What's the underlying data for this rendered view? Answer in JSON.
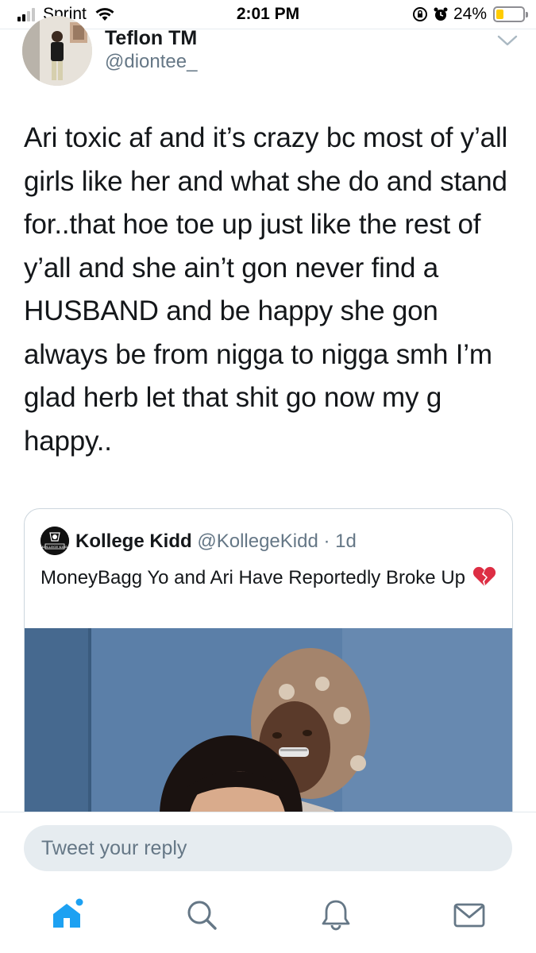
{
  "status_bar": {
    "carrier": "Sprint",
    "time": "2:01 PM",
    "battery_percent_label": "24%",
    "battery_level": 0.24,
    "battery_color": "#ffcc00"
  },
  "tweet": {
    "author_name": "Teflon TM",
    "author_handle": "@diontee_",
    "text": "Ari toxic af and it’s crazy bc most of y’all girls like her and what she do and stand for..that hoe toe up just like the rest of y’all and she ain’t gon never find a HUSBAND and be happy she gon always be from nigga to nigga smh I’m glad herb let that shit go now my g happy.."
  },
  "quote_tweet": {
    "name": "Kollege Kidd",
    "handle": "@KollegeKidd",
    "separator": "·",
    "age": "1d",
    "text": "MoneyBagg Yo and Ari Have Reportedly Broke Up",
    "emoji_icon": "broken-heart-icon",
    "avatar_logo_text": "KOLLEGE KIDD"
  },
  "reply": {
    "placeholder": "Tweet your reply"
  },
  "tab_bar": {
    "items": [
      "home-icon",
      "search-icon",
      "notifications-bell-icon",
      "messages-envelope-icon"
    ],
    "accent_color": "#1da1f2",
    "inactive_color": "#657786"
  }
}
